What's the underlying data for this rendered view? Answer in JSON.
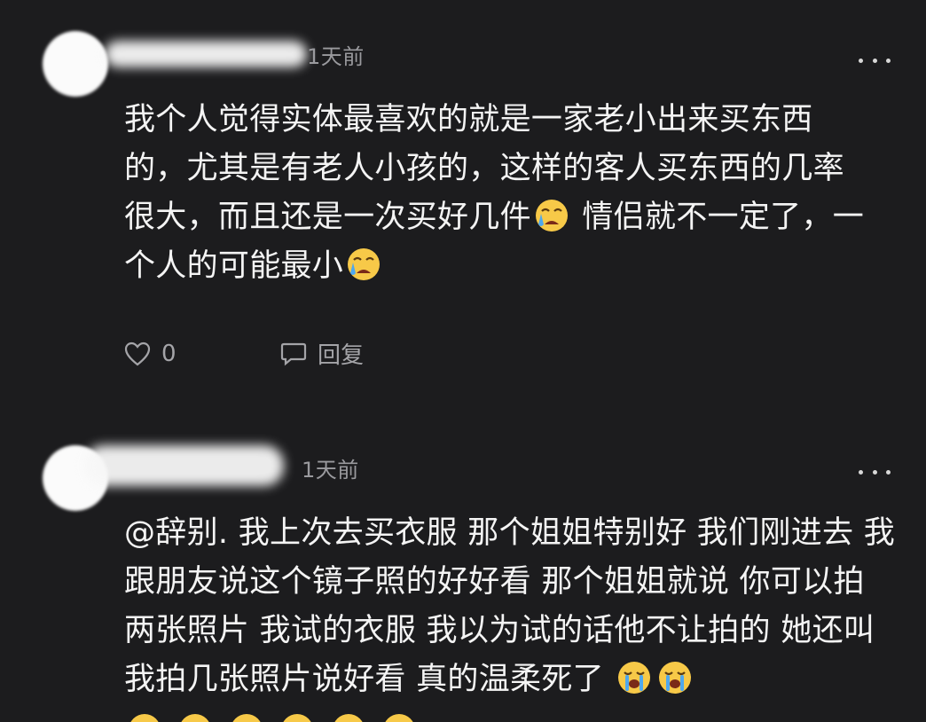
{
  "comments": [
    {
      "timestamp": "1天前",
      "text_before_emoji_1": "我个人觉得实体最喜欢的就是一家老小出来买东西的，尤其是有老人小孩的，这样的客人买东西的几率很大，而且还是一次买好几件",
      "text_before_emoji_2": " 情侣就不一定了，一个人的可能最小",
      "emoji": "crying-face",
      "like_count": "0",
      "reply_label": "回复"
    },
    {
      "timestamp": "1天前",
      "text": "@辞别. 我上次去买衣服 那个姐姐特别好 我们刚进去 我跟朋友说这个镜子照的好好看 那个姐姐就说 你可以拍两张照片 我试的衣服 我以为试的话他不让拍的 她还叫我拍几张照片说好看 真的温柔死了",
      "emoji": "loudly-crying-face"
    }
  ],
  "colors": {
    "background": "#1c1c1e",
    "text": "#f4f4f4",
    "muted": "#9a9a9e",
    "emoji_yellow": "#f7c948"
  }
}
